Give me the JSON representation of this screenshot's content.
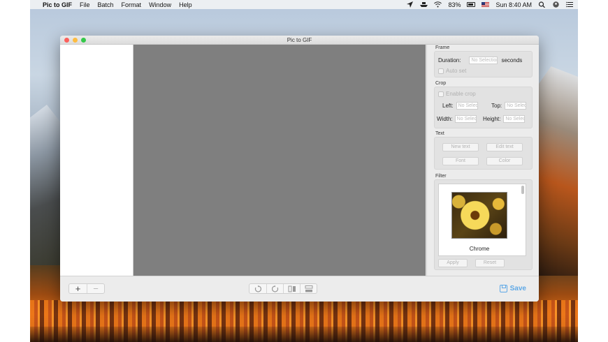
{
  "menubar": {
    "apple_glyph": "",
    "app_name": "Pic to GIF",
    "menus": [
      "File",
      "Batch",
      "Format",
      "Window",
      "Help"
    ],
    "battery": "83%",
    "clock": "Sun 8:40 AM"
  },
  "window": {
    "title": "Pic to GIF"
  },
  "inspector": {
    "frame": {
      "heading": "Frame",
      "duration_label": "Duration:",
      "duration_placeholder": "No Selection",
      "seconds_label": "seconds",
      "auto_set_label": "Auto set"
    },
    "crop": {
      "heading": "Crop",
      "enable_label": "Enable crop",
      "left_label": "Left:",
      "top_label": "Top:",
      "width_label": "Width:",
      "height_label": "Height:",
      "placeholder": "No Selection"
    },
    "text": {
      "heading": "Text",
      "new_text": "New text",
      "edit_text": "Edit text",
      "font": "Font",
      "color": "Color"
    },
    "filter": {
      "heading": "Filter",
      "selected": "Chrome",
      "apply": "Apply",
      "reset": "Reset"
    }
  },
  "bottombar": {
    "add_glyph": "+",
    "remove_glyph": "−",
    "save_label": "Save"
  },
  "colors": {
    "accent": "#5ea8e6",
    "preview_bg": "#7f7f7f"
  }
}
